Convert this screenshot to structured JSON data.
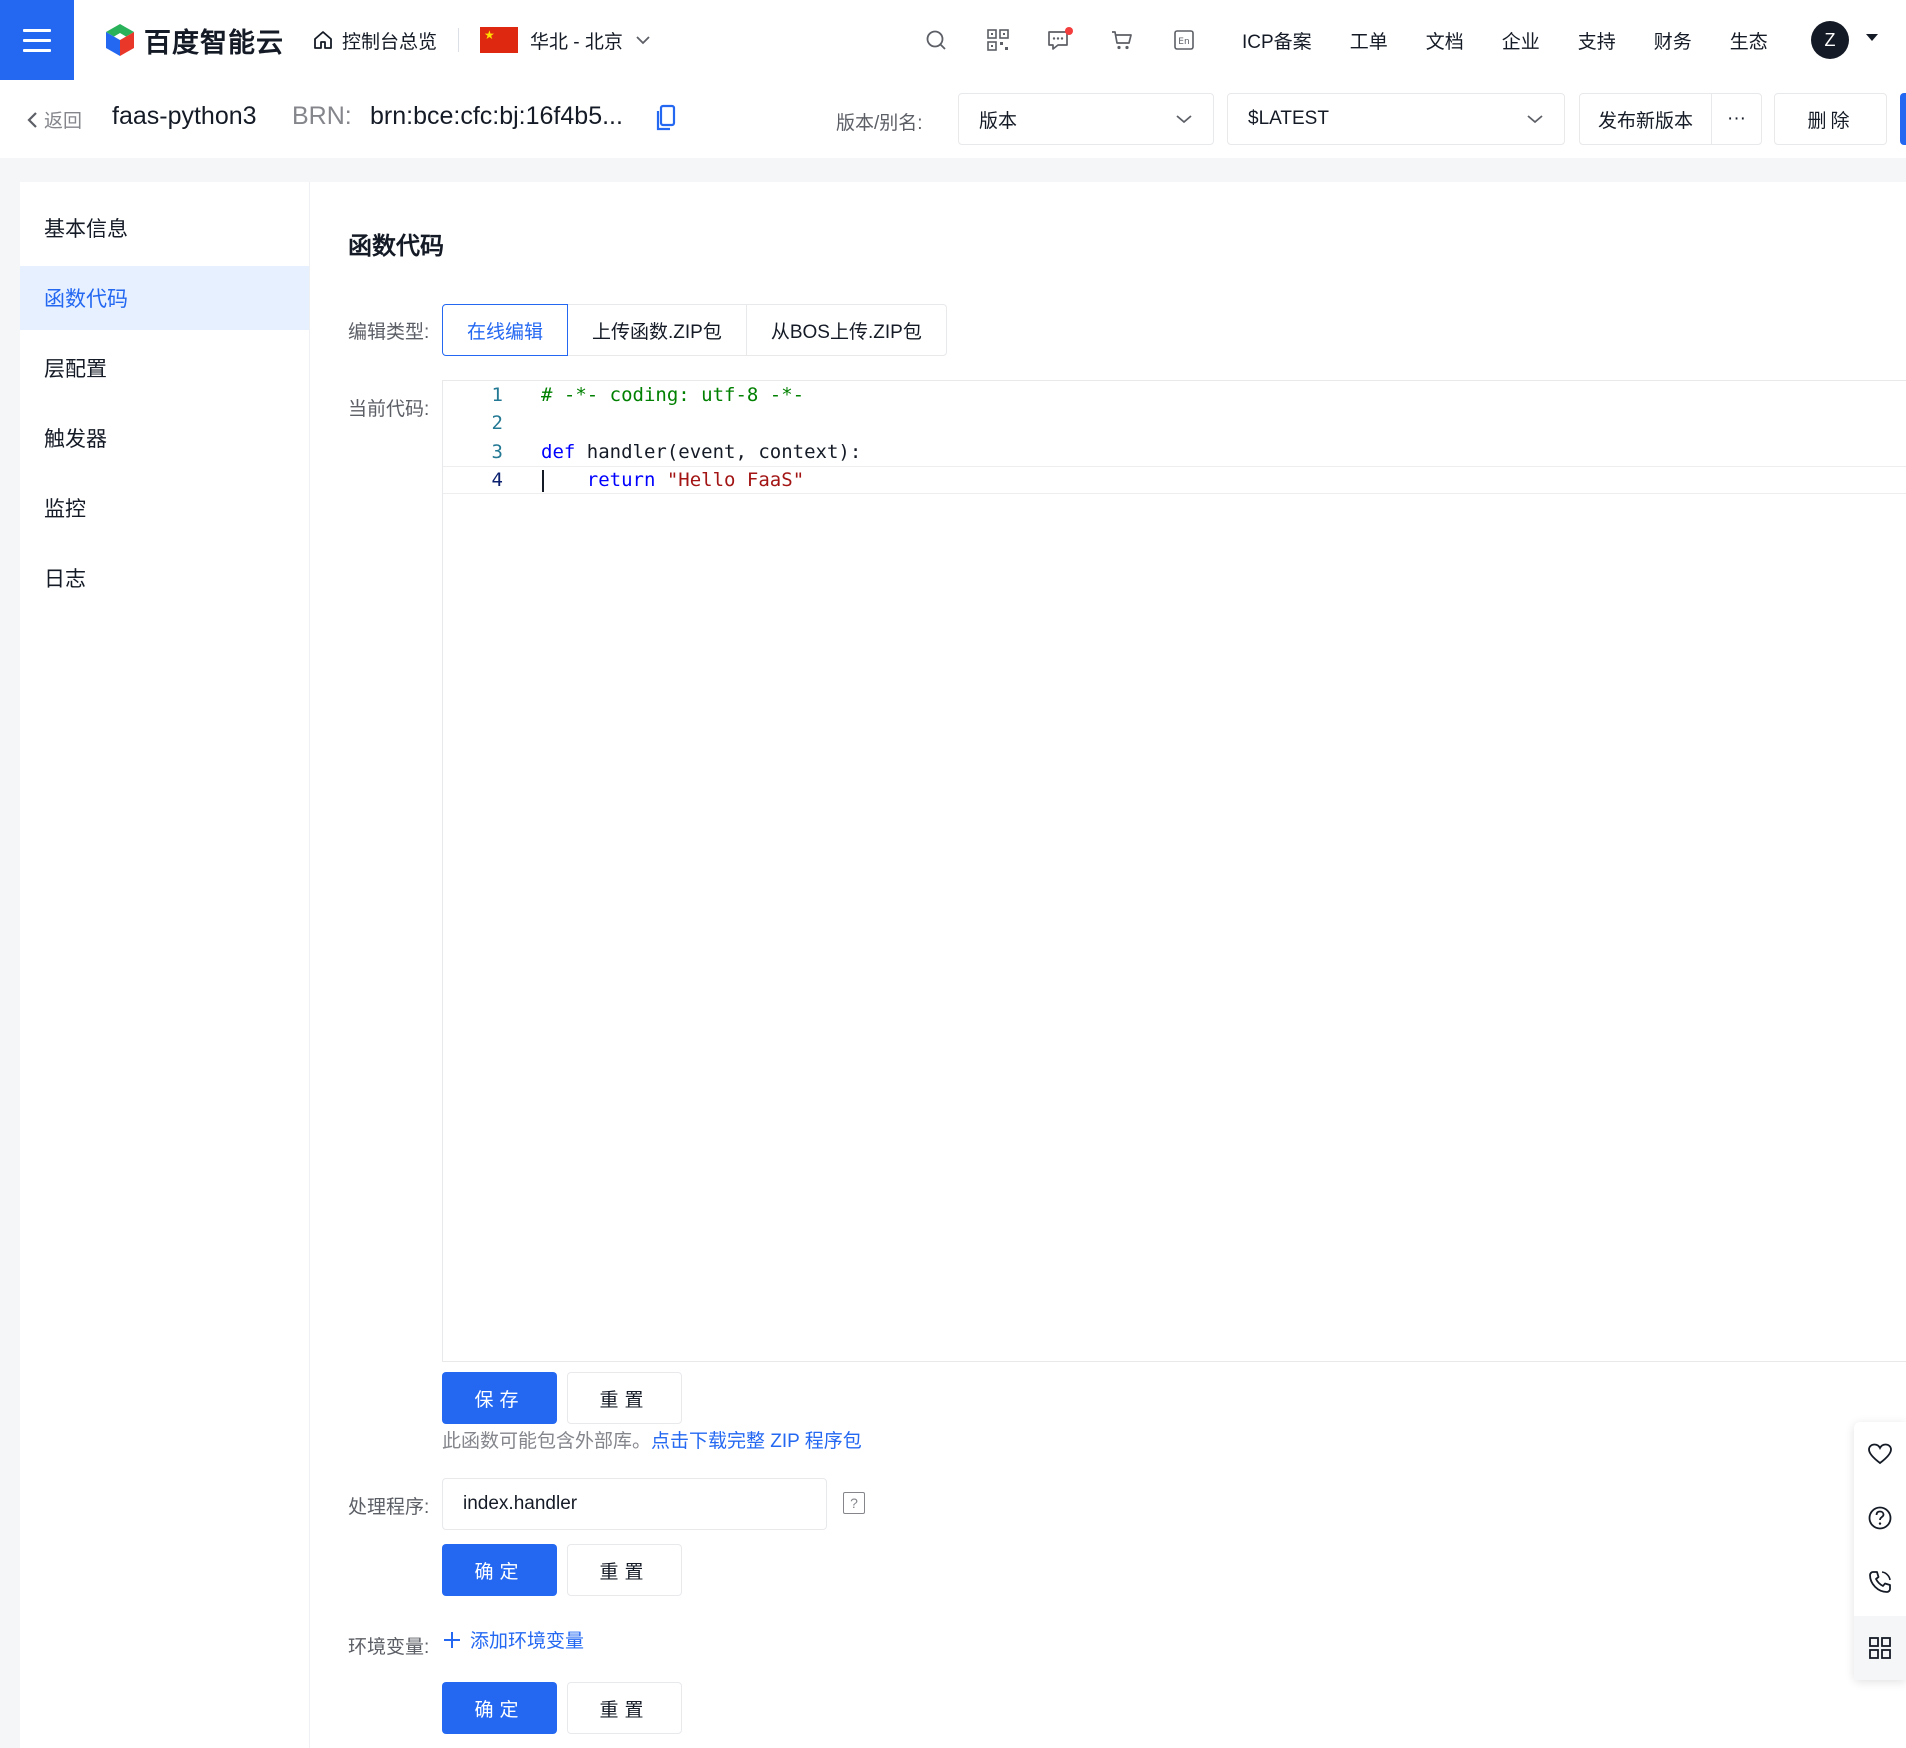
{
  "nav": {
    "logo_text": "百度智能云",
    "home_label": "控制台总览",
    "region_label": "华北 - 北京",
    "links": [
      "ICP备案",
      "工单",
      "文档",
      "企业",
      "支持",
      "财务",
      "生态"
    ],
    "avatar_letter": "Z",
    "icons": [
      "search-icon",
      "qrcode-icon",
      "message-icon",
      "cart-icon",
      "language-en-icon"
    ]
  },
  "header": {
    "back_label": "返回",
    "function_name": "faas-python3",
    "brn_label": "BRN:",
    "brn_value": "brn:bce:cfc:bj:16f4b5...",
    "version_alias_label": "版本/别名:",
    "version_select": "版本",
    "version_value": "$LATEST",
    "publish_label": "发布新版本",
    "more_label": "···",
    "delete_label": "删除"
  },
  "sidebar": {
    "items": [
      {
        "label": "基本信息"
      },
      {
        "label": "函数代码"
      },
      {
        "label": "层配置"
      },
      {
        "label": "触发器"
      },
      {
        "label": "监控"
      },
      {
        "label": "日志"
      }
    ],
    "active_index": 1
  },
  "main": {
    "section_title": "函数代码",
    "edit_type_label": "编辑类型:",
    "tabs": [
      "在线编辑",
      "上传函数.ZIP包",
      "从BOS上传.ZIP包"
    ],
    "active_tab": 0,
    "current_code_label": "当前代码:",
    "code_lines": [
      {
        "num": "1",
        "text": "# -*- coding: utf-8 -*-"
      },
      {
        "num": "2",
        "text": ""
      },
      {
        "num": "3",
        "text": "def handler(event, context):"
      },
      {
        "num": "4",
        "text": "    return \"Hello FaaS\""
      }
    ],
    "save_label": "保存",
    "reset_label": "重置",
    "tip_text": "此函数可能包含外部库。",
    "tip_link": "点击下载完整 ZIP 程序包",
    "handler_label": "处理程序:",
    "handler_value": "index.handler",
    "confirm_label": "确定",
    "env_label": "环境变量:",
    "add_env_label": "添加环境变量"
  },
  "float_toolbar": [
    "heart-icon",
    "help-circle-icon",
    "phone-icon",
    "grid-icon"
  ],
  "colors": {
    "primary": "#2468f2",
    "text": "#151b26",
    "muted": "#84868c",
    "active_bg": "#e6f0ff"
  }
}
